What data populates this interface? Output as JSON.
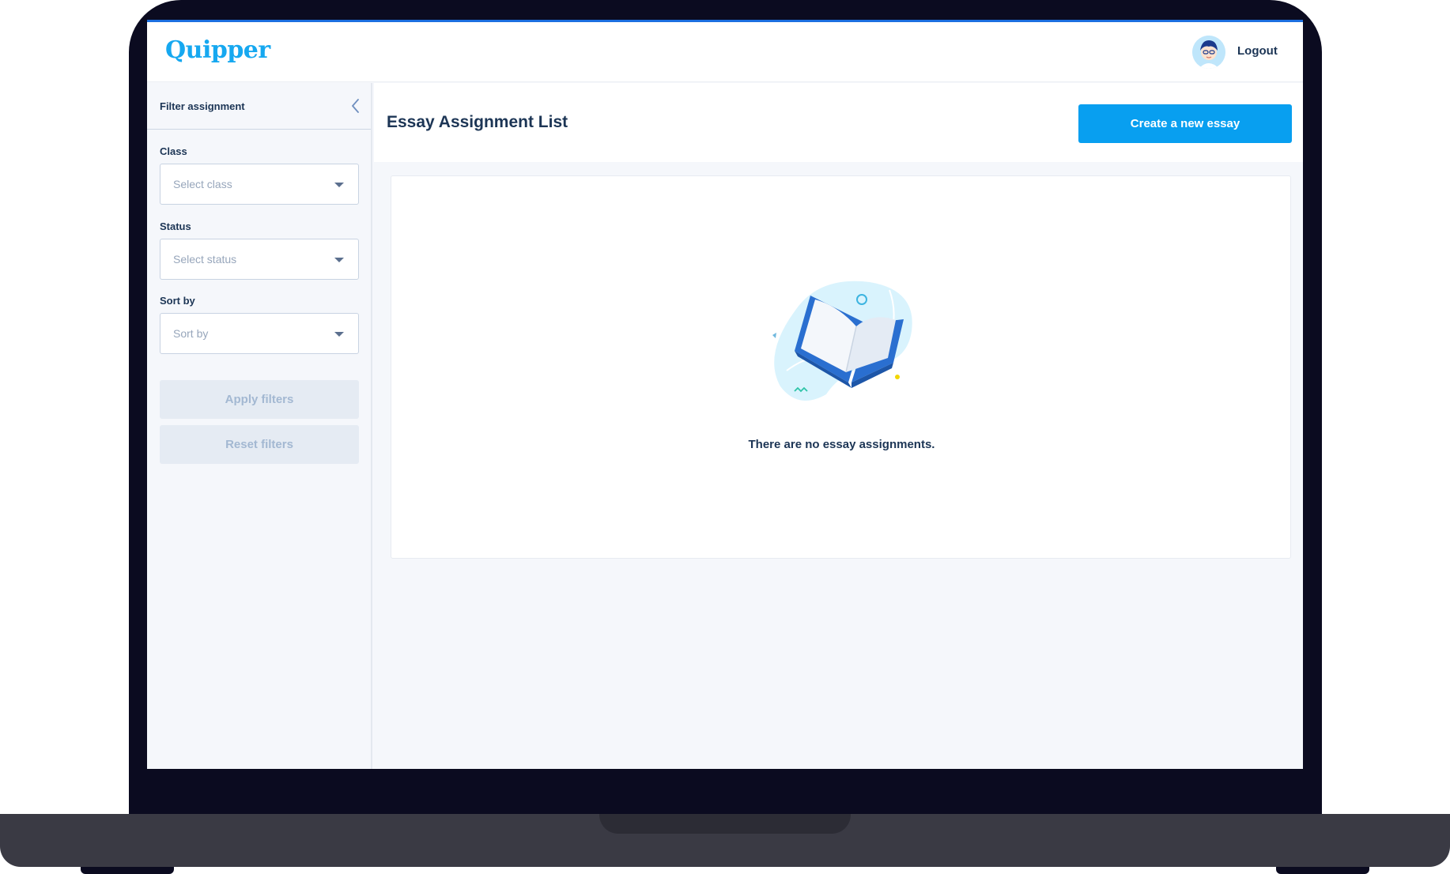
{
  "header": {
    "logo_text": "Quipper",
    "logout_label": "Logout"
  },
  "sidebar": {
    "title": "Filter assignment",
    "class_field": {
      "label": "Class",
      "placeholder": "Select class"
    },
    "status_field": {
      "label": "Status",
      "placeholder": "Select status"
    },
    "sort_field": {
      "label": "Sort by",
      "placeholder": "Sort by"
    },
    "apply_label": "Apply filters",
    "reset_label": "Reset filters"
  },
  "main": {
    "title": "Essay Assignment List",
    "create_label": "Create a new essay",
    "empty_message": "There are no essay assignments."
  },
  "icons": {
    "collapse": "chevron-left-icon",
    "dropdown": "caret-down-icon",
    "illustration": "open-book-icon"
  },
  "colors": {
    "brand": "#16a8f0",
    "primary_button": "#089ff0",
    "text_dark": "#1c3555",
    "disabled_bg": "#e5ebf3",
    "disabled_text": "#a3b8d2",
    "accent_bar": "#1b6fe0"
  }
}
